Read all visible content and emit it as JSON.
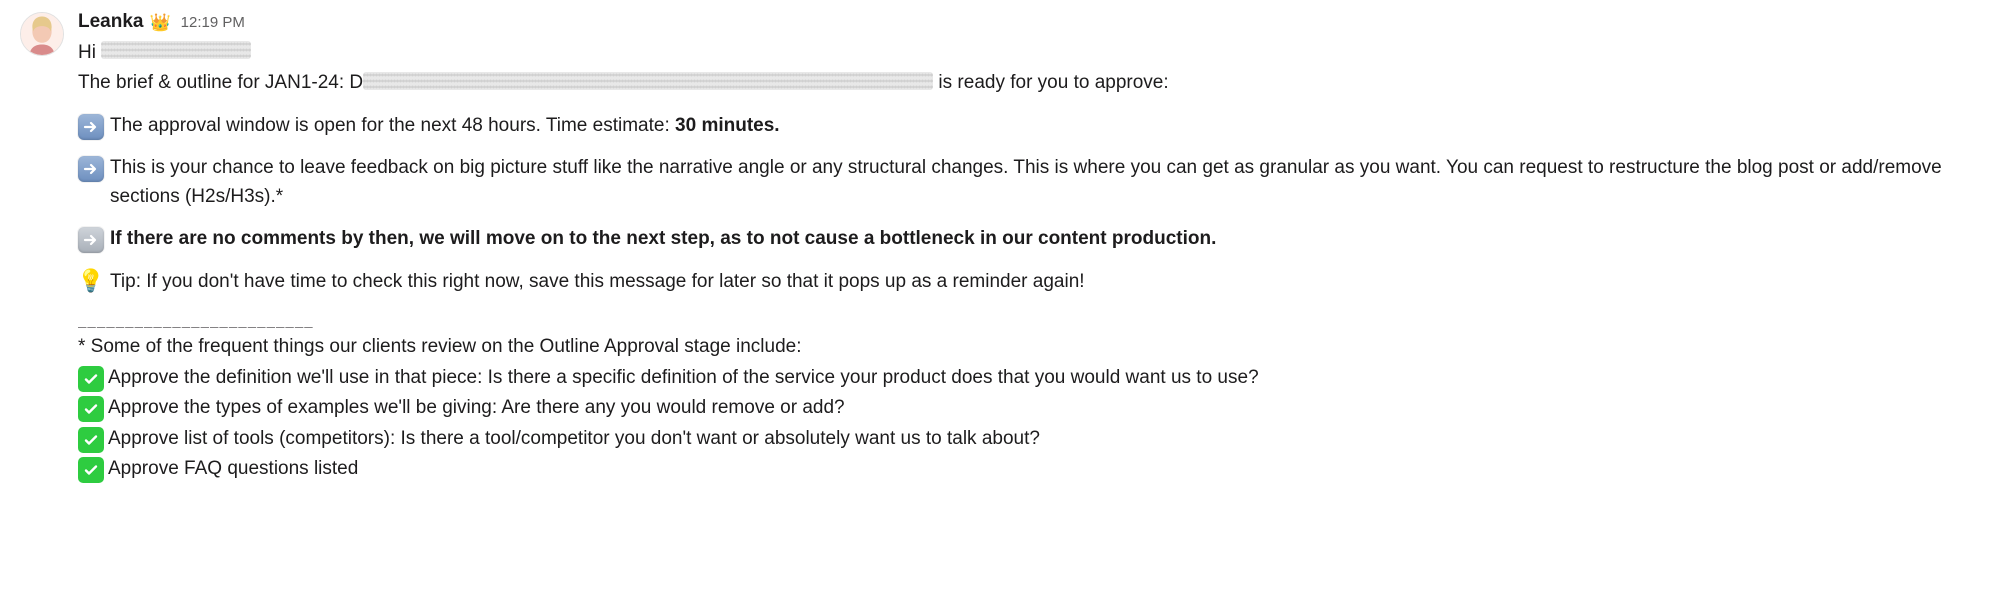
{
  "sender": "Leanka",
  "status_emoji": "👑",
  "timestamp": "12:19 PM",
  "greeting_prefix": "Hi ",
  "brief_prefix": "The brief & outline for JAN1-24: D",
  "brief_suffix": " is ready for you to approve:",
  "bullets": {
    "b1_prefix": "The approval window is open for the next 48 hours. Time estimate: ",
    "b1_bold": "30 minutes.",
    "b2": "This is your chance to leave feedback on big picture stuff like the narrative angle or any structural changes. This is where you can get as granular as you want. You can request to restructure the blog post or add/remove sections (H2s/H3s).*",
    "b3": " If there are no comments by then, we will move on to the next step, as to not cause a bottleneck in our content production.",
    "tip": "Tip: If you don't have time to check this right now, save this message for later so that it pops up as a reminder again!"
  },
  "divider": "_________________________",
  "review_intro": "*  Some of the frequent things our clients review on the Outline Approval stage include:",
  "checks": {
    "c1": "Approve the definition we'll use in that piece: Is there a specific definition of the service your product does that you would want us to use?",
    "c2": "Approve the types of examples we'll be giving: Are there any you would remove or add?",
    "c3": "Approve list of tools (competitors): Is there a tool/competitor you don't want or absolutely want us to talk about?",
    "c4": "Approve FAQ questions listed"
  }
}
